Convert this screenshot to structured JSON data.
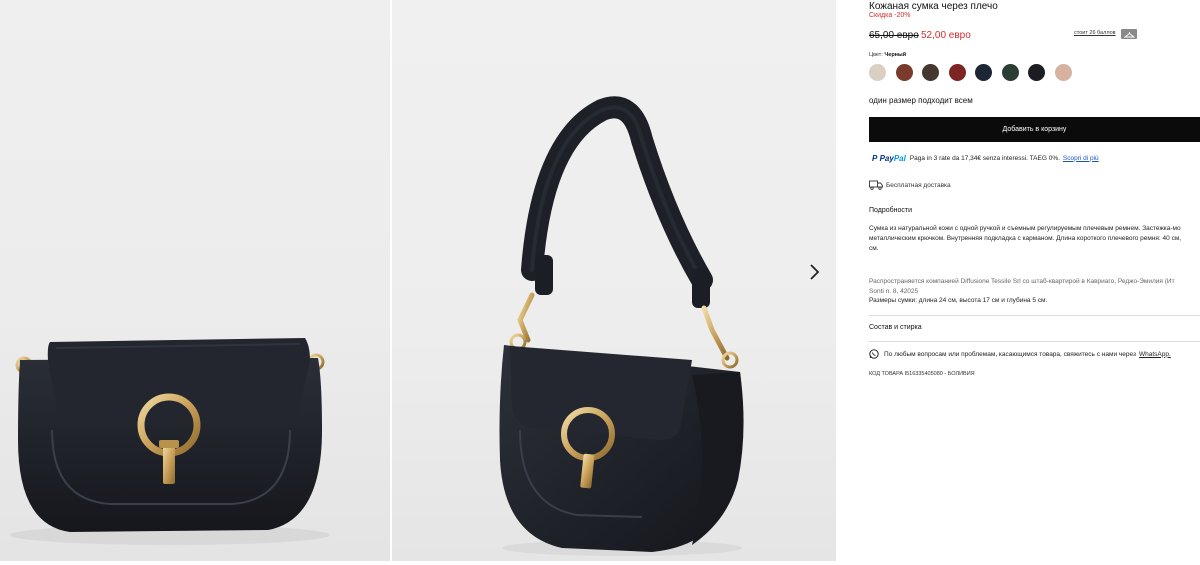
{
  "product": {
    "title": "Кожаная сумка через плечо",
    "discount": "Скидка -20%",
    "price_old": "65,00 евро",
    "price_new": "52,00 евро",
    "points_link": "стоит 26 баллов",
    "color_label": "Цвет:",
    "color_value": "Черный",
    "swatches": [
      {
        "name": "beige",
        "hex": "#d9cfc2"
      },
      {
        "name": "brown",
        "hex": "#7a3a2c"
      },
      {
        "name": "dark-brown",
        "hex": "#453833"
      },
      {
        "name": "burgundy",
        "hex": "#7d2424"
      },
      {
        "name": "navy",
        "hex": "#1e2535"
      },
      {
        "name": "dark-green",
        "hex": "#2d3d34"
      },
      {
        "name": "black",
        "hex": "#1b1d22"
      },
      {
        "name": "nude",
        "hex": "#d7b2a1"
      }
    ],
    "size_text": "один размер подходит всем",
    "add_to_cart": "Добавить в корзину",
    "paypal_brand_1": "Pay",
    "paypal_brand_2": "Pal",
    "paypal_text": "Paga in 3 rate da 17,34€ senza interessi. TAEG 0%.",
    "paypal_link": "Scopri di più",
    "shipping": "Бесплатная доставка",
    "details_title": "Подробности",
    "desc_line_1": "Сумка из натуральной кожи с одной ручкой и съемным регулируемым плечевым ремнем. Застежка-мо",
    "desc_line_2": "металлическим крючком. Внутренняя подкладка с карманом. Длина короткого плечевого ремня: 40 см,",
    "desc_line_3": "см.",
    "distributor_line_1": "Распространяется компанией Diffusione Tessile Srl со штаб-квартирой в Кавриаго, Реджо-Эмилия (Ит",
    "distributor_line_2": "Sonti n. 8, 42025",
    "dimensions": "Размеры сумки: длина 24 см, высота 17 см и глубина 5 см.",
    "care": "Состав и стирка",
    "whatsapp_text": "По любым вопросам или проблемам, касающимся товара, свяжитесь с нами через",
    "whatsapp_link": "WhatsApp.",
    "sku": "КОД ТОВАРА I516335405080 - БОЛИВИЯ"
  },
  "gallery": {
    "next_arrow": "chevron-right-icon"
  },
  "colors": {
    "accent_red": "#d32f2f",
    "button_bg": "#0b0b0b",
    "bag_leather": "#1f2229",
    "gold_hardware": "#caa35c"
  }
}
